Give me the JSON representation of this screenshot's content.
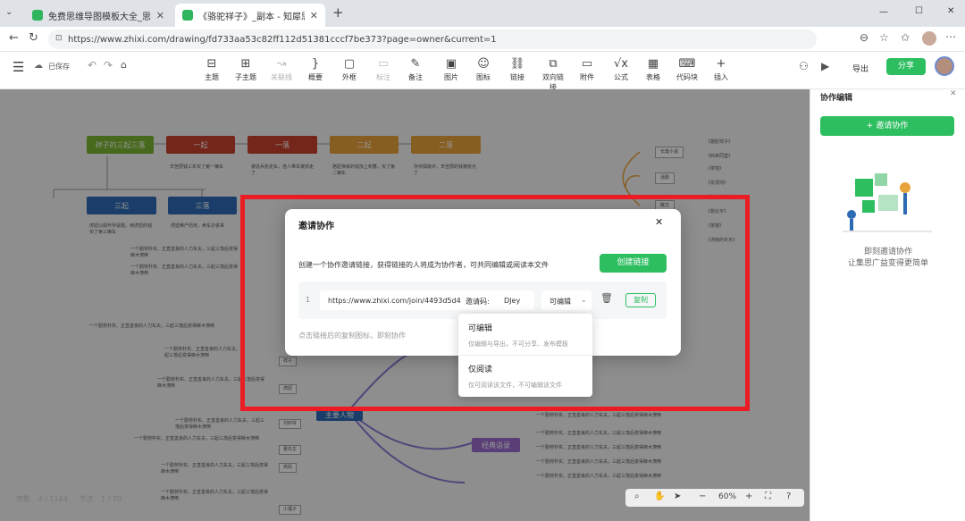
{
  "browser": {
    "tabs": [
      {
        "title": "免费思维导图模板大全_思维导图演示",
        "active": false
      },
      {
        "title": "《骆驼祥子》_副本 - 知犀思维导图",
        "active": true
      }
    ],
    "new_tab": "+",
    "url": "https://www.zhixi.com/drawing/fd733aa53c82ff112d51381cccf7be373?page=owner&current=1",
    "window_controls": [
      "—",
      "☐",
      "✕"
    ]
  },
  "app": {
    "save_status": "已保存",
    "tools": [
      {
        "label": "主题",
        "icon": "topic-icon",
        "glyph": "⊟",
        "enabled": true
      },
      {
        "label": "子主题",
        "icon": "subtopic-icon",
        "glyph": "⊞",
        "enabled": true
      },
      {
        "label": "关联线",
        "icon": "relation-icon",
        "glyph": "↝",
        "enabled": false
      },
      {
        "label": "概要",
        "icon": "summary-icon",
        "glyph": "}",
        "enabled": true
      },
      {
        "label": "外框",
        "icon": "frame-icon",
        "glyph": "▢",
        "enabled": true
      },
      {
        "label": "标注",
        "icon": "callout-icon",
        "glyph": "▭",
        "enabled": false
      },
      {
        "label": "备注",
        "icon": "note-icon",
        "glyph": "✎",
        "enabled": true
      },
      {
        "label": "图片",
        "icon": "image-icon",
        "glyph": "▣",
        "enabled": true
      },
      {
        "label": "图标",
        "icon": "emoji-icon",
        "glyph": "☺",
        "enabled": true
      },
      {
        "label": "链接",
        "icon": "link-icon",
        "glyph": "⛓",
        "enabled": true
      },
      {
        "label": "双向链接",
        "icon": "bilink-icon",
        "glyph": "⧉",
        "enabled": true
      },
      {
        "label": "附件",
        "icon": "attachment-icon",
        "glyph": "▭",
        "enabled": true
      },
      {
        "label": "公式",
        "icon": "formula-icon",
        "glyph": "√x",
        "enabled": true
      },
      {
        "label": "表格",
        "icon": "table-icon",
        "glyph": "▦",
        "enabled": true
      },
      {
        "label": "代码块",
        "icon": "code-icon",
        "glyph": "⌨",
        "enabled": true
      },
      {
        "label": "插入",
        "icon": "insert-icon",
        "glyph": "+",
        "enabled": true
      }
    ],
    "export_label": "导出",
    "share_label": "分享"
  },
  "side_panel": {
    "title": "协作编辑",
    "invite_button": "+ 邀请协作",
    "caption_line1": "即刻邀请协作",
    "caption_line2": "让集思广益变得更简单"
  },
  "status_bar": {
    "words_label": "字数",
    "words_value": "4 / 1164",
    "nodes_label": "节点",
    "nodes_value": "1 / 70",
    "zoom": "60%"
  },
  "mindmap": {
    "top_nodes": [
      "祥子的三起三落",
      "一起",
      "一落",
      "二起",
      "二落"
    ],
    "top_notes": [
      "辛苦攒钱三年买了第一辆车",
      "被逃兵抢走车，连人带车被抓走了",
      "骆驼换来的钱加上积蓄，买了第二辆车",
      "孙侦探敲诈，辛苦攒的钱被抢光了"
    ],
    "mid_nodes": [
      "三起",
      "三落"
    ],
    "mid_notes": [
      "虎妞以假怀孕逼婚，用虎妞的钱买了第三辆车",
      "虎妞难产而死，卖车办丧事"
    ],
    "center_node": "主要人物",
    "classic_node": "经典语录",
    "right_small": [
      "长篇小说",
      "《骆驼祥子》",
      "《四世同堂》",
      "话剧",
      "《茶馆》",
      "《龙须沟》",
      "散文",
      "《济南的冬天》",
      "《想北平》"
    ],
    "left_tags": [
      "祥子",
      "虎妞",
      "刘四爷",
      "曹先生",
      "高妈",
      "小福子"
    ],
    "paragraph_text": "一个勤劳朴实、正直善良的人力车夫，三起三落后变得麻木潦倒"
  },
  "dialog": {
    "title": "邀请协作",
    "description": "创建一个协作邀请链接，获得链接的人将成为协作者，可共同编辑或阅读本文件",
    "create_button": "创建链接",
    "row_index": "1",
    "link_url": "https://www.zhixi.com/join/4493d5d4",
    "code_label": "邀请码:",
    "code_value": "DJey",
    "permission": "可编辑",
    "copy_button": "复制",
    "hint": "点击链接后的复制图标，即刻协作"
  },
  "dropdown": {
    "options": [
      {
        "label": "可编辑",
        "desc": "仅编辑与导出，不可分享、发布模板"
      },
      {
        "label": "仅阅读",
        "desc": "仅可阅读该文件，不可编辑该文件"
      }
    ]
  },
  "colors": {
    "green": "#2dbe60",
    "red_highlight": "#ec1c24",
    "node_red": "#c8432e",
    "node_orange": "#e8a33a",
    "node_blue": "#2d6bb5",
    "node_green": "#7bb531",
    "node_purple": "#9b6ccf"
  }
}
